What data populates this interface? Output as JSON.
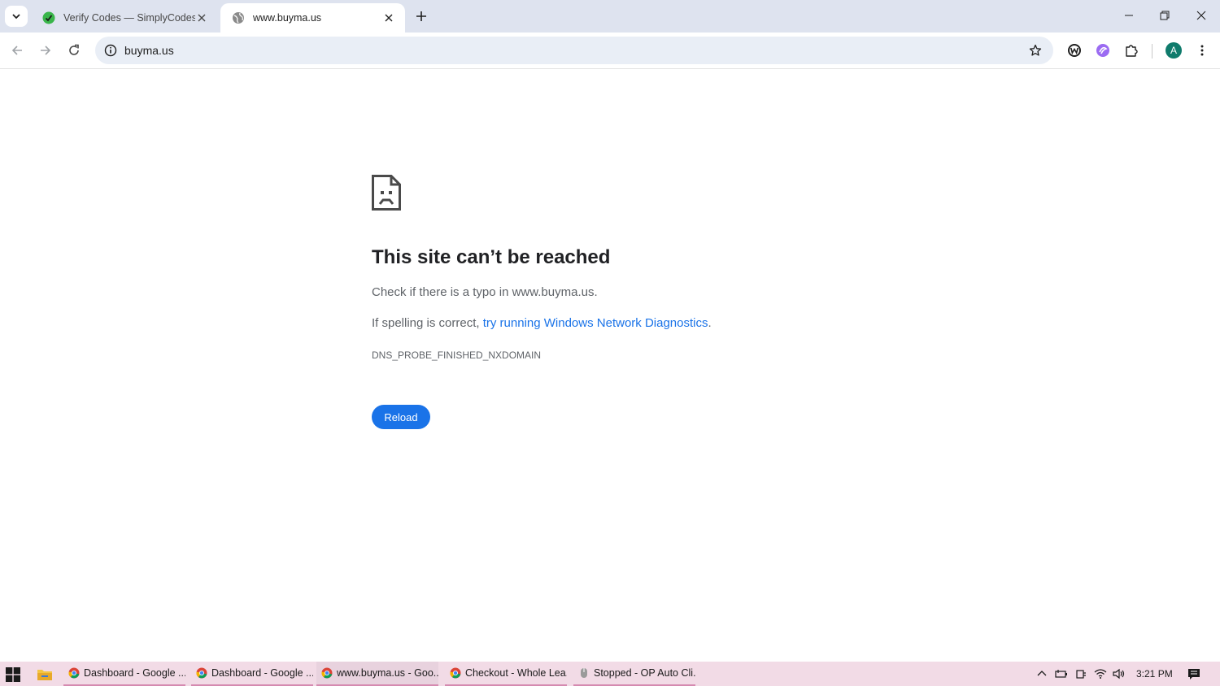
{
  "browser": {
    "tabs": [
      {
        "title": "Verify Codes — SimplyCodes",
        "favicon": "simplycodes-icon",
        "active": false
      },
      {
        "title": "www.buyma.us",
        "favicon": "globe-icon",
        "active": true
      }
    ],
    "address": "buyma.us",
    "profile_initial": "A",
    "accent": "#1a73e8"
  },
  "error_page": {
    "title": "This site can’t be reached",
    "line1": "Check if there is a typo in www.buyma.us.",
    "line2_prefix": "If spelling is correct, ",
    "line2_link": "try running Windows Network Diagnostics",
    "line2_suffix": ".",
    "error_code": "DNS_PROBE_FINISHED_NXDOMAIN",
    "reload_label": "Reload"
  },
  "taskbar": {
    "apps": [
      {
        "label": "Dashboard - Google ...",
        "icon": "chrome-icon"
      },
      {
        "label": "Dashboard - Google ...",
        "icon": "chrome-icon"
      },
      {
        "label": "www.buyma.us - Goo...",
        "icon": "chrome-icon",
        "active": true
      },
      {
        "label": "Checkout - Whole Lea...",
        "icon": "chrome-icon"
      },
      {
        "label": "Stopped - OP Auto Cli...",
        "icon": "mouse-icon"
      }
    ],
    "clock": "3:21 PM"
  }
}
